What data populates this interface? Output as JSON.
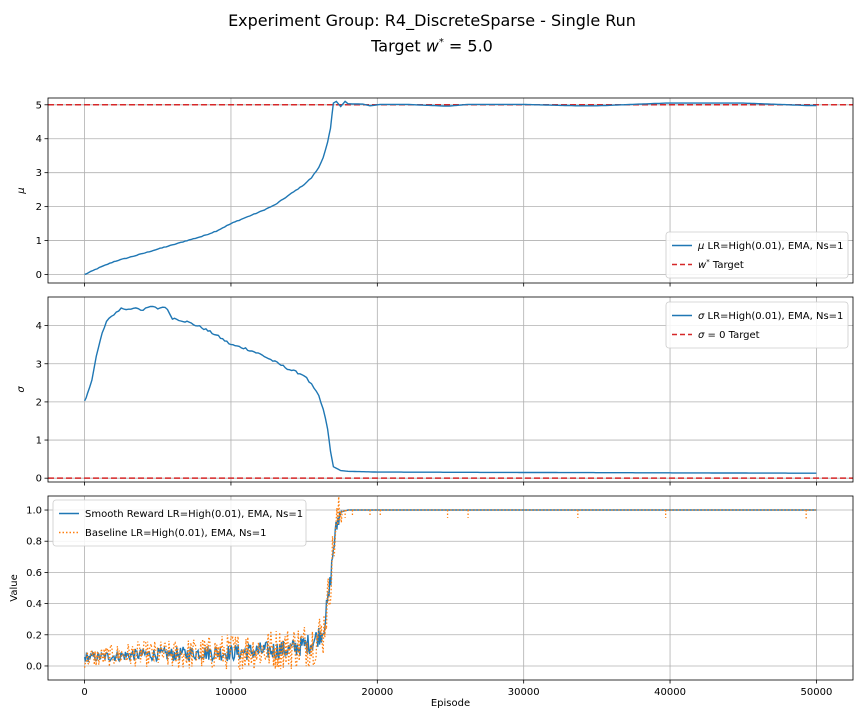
{
  "title_line1": "Experiment Group: R4_DiscreteSparse - Single Run",
  "title_line2": "Target w* = 5.0",
  "xlabel": "Episode",
  "chart_data": [
    {
      "type": "line",
      "ylabel": "μ",
      "xlim": [
        -2500,
        52500
      ],
      "ylim": [
        -0.25,
        5.2
      ],
      "yticks": [
        0,
        1,
        2,
        3,
        4,
        5
      ],
      "xticks": [
        0,
        10000,
        20000,
        30000,
        40000,
        50000
      ],
      "grid": true,
      "legend": "lower-right",
      "hlines": [
        {
          "name": "w* Target",
          "y": 5.0,
          "color": "#d62728",
          "style": "dashed"
        }
      ],
      "series": [
        {
          "name": "μ LR=High(0.01), EMA, Ns=1",
          "color": "#1f77b4",
          "style": "solid",
          "x": [
            0,
            1000,
            2000,
            3000,
            4000,
            5000,
            6000,
            7000,
            8000,
            9000,
            10000,
            11000,
            12000,
            13000,
            14000,
            15000,
            15500,
            16000,
            16300,
            16600,
            16800,
            17000,
            17200,
            17500,
            17800,
            18000,
            19000,
            19500,
            20200,
            22000,
            24800,
            26200,
            30000,
            33700,
            35000,
            39700,
            45000,
            49300,
            50000
          ],
          "y": [
            0.0,
            0.2,
            0.38,
            0.5,
            0.62,
            0.75,
            0.87,
            1.0,
            1.12,
            1.28,
            1.5,
            1.68,
            1.85,
            2.05,
            2.35,
            2.65,
            2.85,
            3.15,
            3.45,
            3.9,
            4.3,
            5.05,
            5.1,
            4.95,
            5.1,
            5.03,
            5.02,
            4.97,
            5.01,
            5.01,
            4.96,
            5.01,
            5.01,
            4.97,
            4.97,
            5.05,
            5.05,
            4.98,
            4.98
          ]
        }
      ]
    },
    {
      "type": "line",
      "ylabel": "σ",
      "xlim": [
        -2500,
        52500
      ],
      "ylim": [
        -0.1,
        4.75
      ],
      "yticks": [
        0,
        1,
        2,
        3,
        4
      ],
      "xticks": [
        0,
        10000,
        20000,
        30000,
        40000,
        50000
      ],
      "grid": true,
      "legend": "top-right",
      "hlines": [
        {
          "name": "σ = 0 Target",
          "y": 0,
          "color": "#d62728",
          "style": "dashed"
        }
      ],
      "series": [
        {
          "name": "σ LR=High(0.01), EMA, Ns=1",
          "color": "#1f77b4",
          "style": "solid",
          "x": [
            0,
            200,
            500,
            800,
            1200,
            1500,
            2000,
            2500,
            3000,
            3500,
            4000,
            4500,
            5000,
            5500,
            6000,
            7000,
            8000,
            9000,
            10000,
            11000,
            12000,
            13000,
            14000,
            15000,
            15500,
            16000,
            16300,
            16600,
            16800,
            17000,
            17500,
            18000,
            20000,
            30000,
            40000,
            50000
          ],
          "y": [
            2.0,
            2.2,
            2.6,
            3.2,
            3.8,
            4.1,
            4.3,
            4.45,
            4.42,
            4.48,
            4.4,
            4.5,
            4.45,
            4.5,
            4.2,
            4.1,
            3.95,
            3.75,
            3.5,
            3.4,
            3.25,
            3.05,
            2.85,
            2.7,
            2.45,
            2.15,
            1.8,
            1.3,
            0.7,
            0.3,
            0.2,
            0.18,
            0.16,
            0.15,
            0.14,
            0.13
          ]
        }
      ]
    },
    {
      "type": "line",
      "ylabel": "Value",
      "xlim": [
        -2500,
        52500
      ],
      "ylim": [
        -0.09,
        1.09
      ],
      "yticks": [
        0.0,
        0.2,
        0.4,
        0.6,
        0.8,
        1.0
      ],
      "xticks": [
        0,
        10000,
        20000,
        30000,
        40000,
        50000
      ],
      "grid": true,
      "legend": "top-left",
      "series": [
        {
          "name": "Smooth Reward LR=High(0.01), EMA, Ns=1",
          "color": "#1f77b4",
          "style": "solid",
          "x": [
            0,
            2000,
            4000,
            6000,
            8000,
            10000,
            12000,
            14000,
            15500,
            16300,
            16700,
            17000,
            17300,
            17600,
            18000,
            20000,
            30000,
            40000,
            50000
          ],
          "y": [
            0.05,
            0.06,
            0.07,
            0.07,
            0.08,
            0.08,
            0.09,
            0.1,
            0.14,
            0.22,
            0.45,
            0.75,
            0.93,
            0.99,
            1.0,
            1.0,
            1.0,
            1.0,
            1.0
          ]
        },
        {
          "name": "Baseline LR=High(0.01), EMA, Ns=1",
          "color": "#ff7f0e",
          "style": "dotted",
          "x": [
            0,
            2000,
            4000,
            6000,
            8000,
            10000,
            12000,
            14000,
            15500,
            16300,
            16700,
            17000,
            17300,
            17600,
            18000,
            20000,
            30000,
            40000,
            50000
          ],
          "y": [
            0.04,
            0.06,
            0.07,
            0.06,
            0.07,
            0.08,
            0.09,
            0.1,
            0.13,
            0.2,
            0.45,
            0.75,
            0.92,
            0.99,
            1.0,
            1.0,
            1.0,
            1.0,
            1.0
          ],
          "dips": [
            {
              "x": 17800,
              "y": 0.95
            },
            {
              "x": 18300,
              "y": 0.96
            },
            {
              "x": 19500,
              "y": 0.96
            },
            {
              "x": 20200,
              "y": 0.96
            },
            {
              "x": 24800,
              "y": 0.95
            },
            {
              "x": 26200,
              "y": 0.95
            },
            {
              "x": 33700,
              "y": 0.95
            },
            {
              "x": 39700,
              "y": 0.95
            },
            {
              "x": 49300,
              "y": 0.94
            }
          ]
        }
      ]
    }
  ]
}
